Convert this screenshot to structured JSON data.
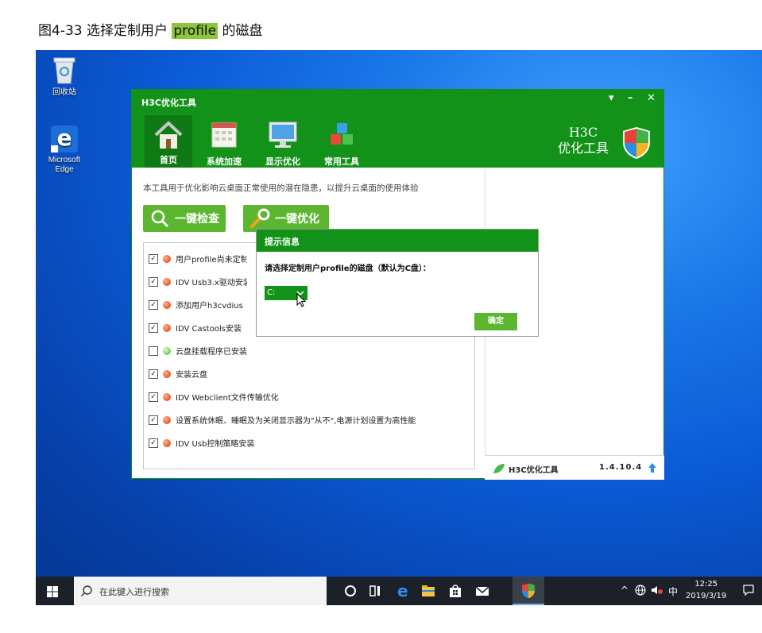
{
  "caption": {
    "prefix": "图4-33 选择定制用户 ",
    "highlight": "profile",
    "suffix": " 的磁盘"
  },
  "desktop": {
    "icons": [
      {
        "label": "回收站"
      },
      {
        "label": "Microsoft Edge"
      }
    ]
  },
  "app": {
    "title": "H3C优化工具",
    "window_controls": {
      "menu": "▾",
      "minimize": "–",
      "close": "✕"
    },
    "nav": [
      {
        "label": "首页",
        "icon": "home-icon"
      },
      {
        "label": "系统加速",
        "icon": "calendar-icon"
      },
      {
        "label": "显示优化",
        "icon": "monitor-icon"
      },
      {
        "label": "常用工具",
        "icon": "cubes-icon"
      }
    ],
    "brand_line1": "H3C",
    "brand_line2": "优化工具",
    "description": "本工具用于优化影响云桌面正常使用的潜在隐患，以提升云桌面的使用体验",
    "buttons": {
      "check": "一键检查",
      "optimize": "一键优化"
    },
    "items": [
      {
        "label": "用户profile尚未定制",
        "checked": true,
        "status": "red"
      },
      {
        "label": "IDV Usb3.x驱动安装",
        "checked": true,
        "status": "red"
      },
      {
        "label": "添加用户h3cvdius",
        "checked": true,
        "status": "red"
      },
      {
        "label": "IDV Castools安装",
        "checked": true,
        "status": "red"
      },
      {
        "label": "云盘挂载程序已安装",
        "checked": false,
        "status": "green"
      },
      {
        "label": "安装云盘",
        "checked": true,
        "status": "red"
      },
      {
        "label": "IDV Webclient文件传输优化",
        "checked": true,
        "status": "red"
      },
      {
        "label": "设置系统休眠、睡眠及为关闭显示器为\"从不\",电源计划设置为高性能",
        "checked": true,
        "status": "red"
      },
      {
        "label": "IDV Usb控制策略安装",
        "checked": true,
        "status": "red"
      }
    ],
    "status_bar": {
      "name": "H3C优化工具",
      "version": "1.4.10.4"
    },
    "colors": {
      "green": "#129218",
      "button_green": "#5db630"
    }
  },
  "dialog": {
    "title": "提示信息",
    "message": "请选择定制用户profile的磁盘（默认为C盘）：",
    "selected_drive": "C:",
    "ok_label": "确定"
  },
  "taskbar": {
    "search_placeholder": "在此键入进行搜索",
    "tray_ime": "中",
    "time": "12:25",
    "date": "2019/3/19"
  }
}
